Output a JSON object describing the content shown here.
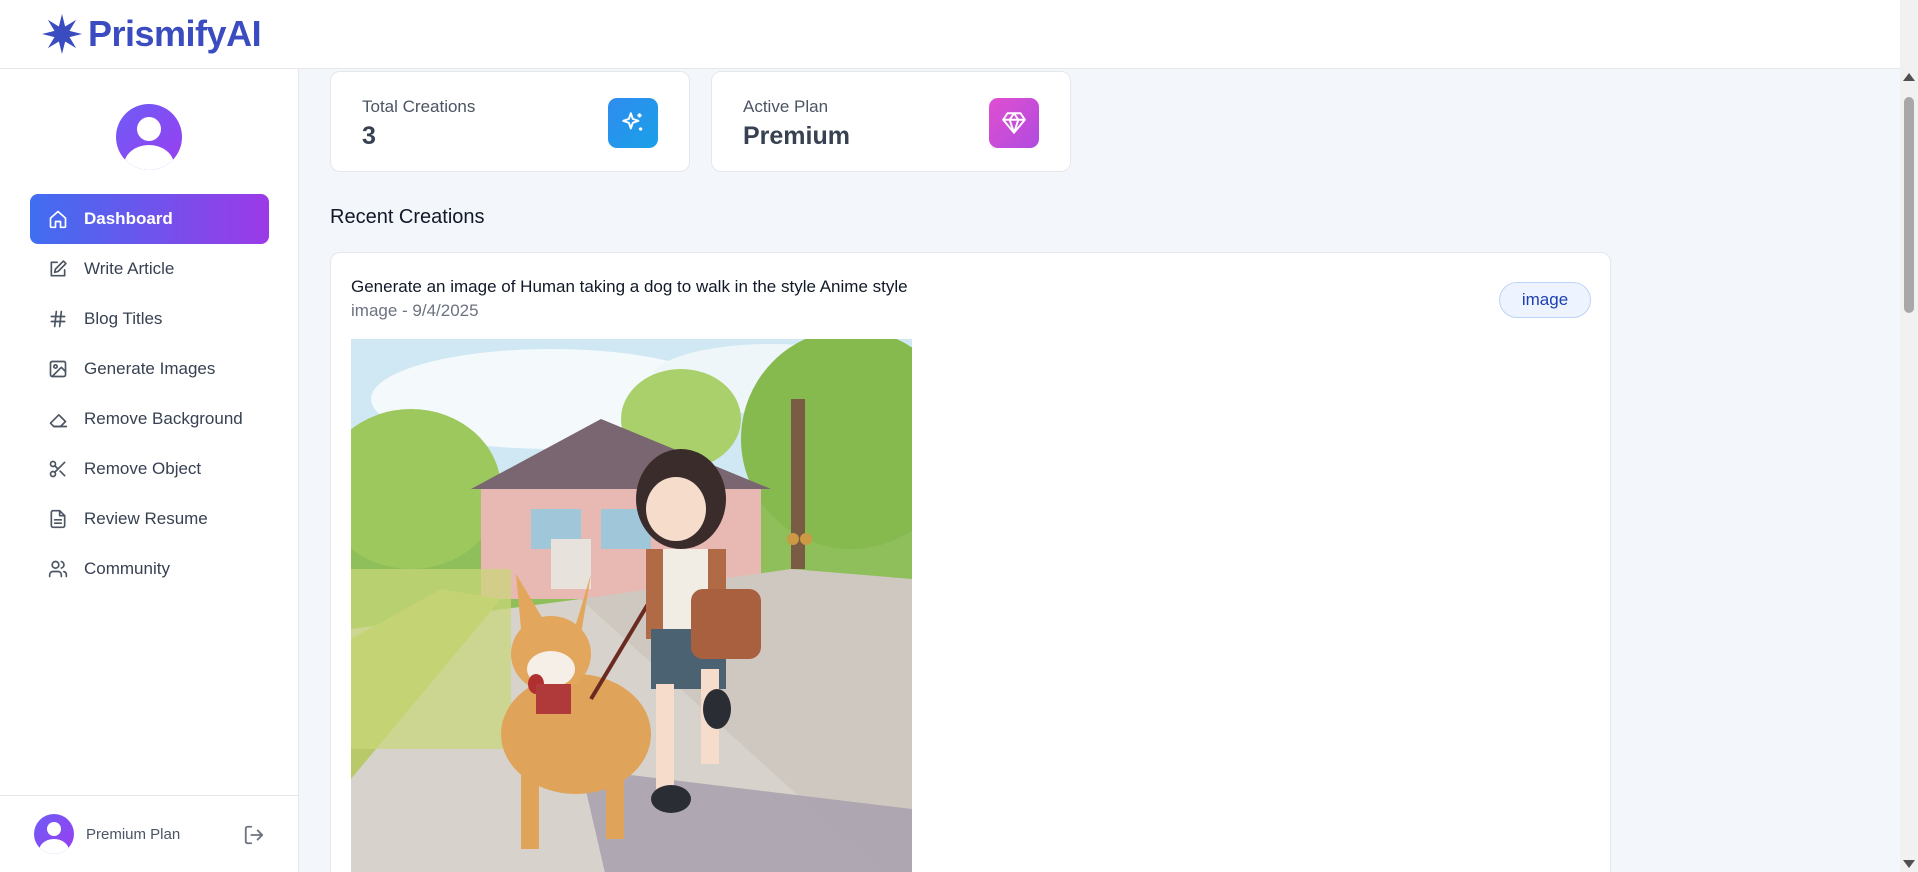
{
  "app": {
    "name": "PrismifyAI"
  },
  "sidebar": {
    "items": [
      {
        "label": "Dashboard",
        "icon": "home-icon",
        "active": true
      },
      {
        "label": "Write Article",
        "icon": "edit-icon"
      },
      {
        "label": "Blog Titles",
        "icon": "hash-icon"
      },
      {
        "label": "Generate Images",
        "icon": "image-icon"
      },
      {
        "label": "Remove Background",
        "icon": "eraser-icon"
      },
      {
        "label": "Remove Object",
        "icon": "scissors-icon"
      },
      {
        "label": "Review Resume",
        "icon": "file-text-icon"
      },
      {
        "label": "Community",
        "icon": "users-icon"
      }
    ],
    "footer": {
      "plan_label": "Premium Plan"
    }
  },
  "stats": {
    "total_creations": {
      "label": "Total Creations",
      "value": "3",
      "icon": "sparkles-icon",
      "color": "#2f8cf0"
    },
    "active_plan": {
      "label": "Active Plan",
      "value": "Premium",
      "icon": "gem-icon",
      "color": "#c84bd8"
    }
  },
  "recent": {
    "title": "Recent Creations",
    "items": [
      {
        "prompt": "Generate an image of Human taking a dog to walk in the style Anime style",
        "meta": "image - 9/4/2025",
        "badge": "image"
      }
    ]
  },
  "colors": {
    "brand": "#3b4cc0",
    "accent_start": "#3f6ef0",
    "accent_end": "#9c3ae8",
    "background": "#f3f6fb"
  }
}
